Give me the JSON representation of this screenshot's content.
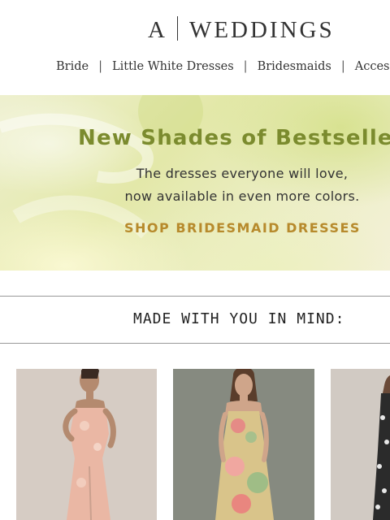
{
  "header": {
    "logo_mark": "A",
    "logo_text": "WEDDINGS"
  },
  "nav": {
    "items": [
      {
        "label": "Bride"
      },
      {
        "label": "Little White Dresses"
      },
      {
        "label": "Bridesmaids"
      },
      {
        "label": "Acces"
      }
    ],
    "separator": "|"
  },
  "banner": {
    "title": "New Shades of Bestseller",
    "subtitle_line1": "The dresses everyone will love,",
    "subtitle_line2": "now available in even more colors.",
    "cta": "SHOP BRIDESMAID DRESSES",
    "colors": {
      "title": "#7b8b2e",
      "cta": "#b78a2c"
    }
  },
  "section": {
    "title": "MADE WITH YOU IN MIND:"
  },
  "products": [
    {
      "image": "model in blush pink floral strapless corset maxi dress",
      "dress_color": "#e9b8a6"
    },
    {
      "image": "model in multicolor watercolor floral slip maxi dress",
      "dress_color": "#d9c48a"
    },
    {
      "image": "model in black and white patterned dress",
      "dress_color": "#2a2a2a"
    }
  ]
}
